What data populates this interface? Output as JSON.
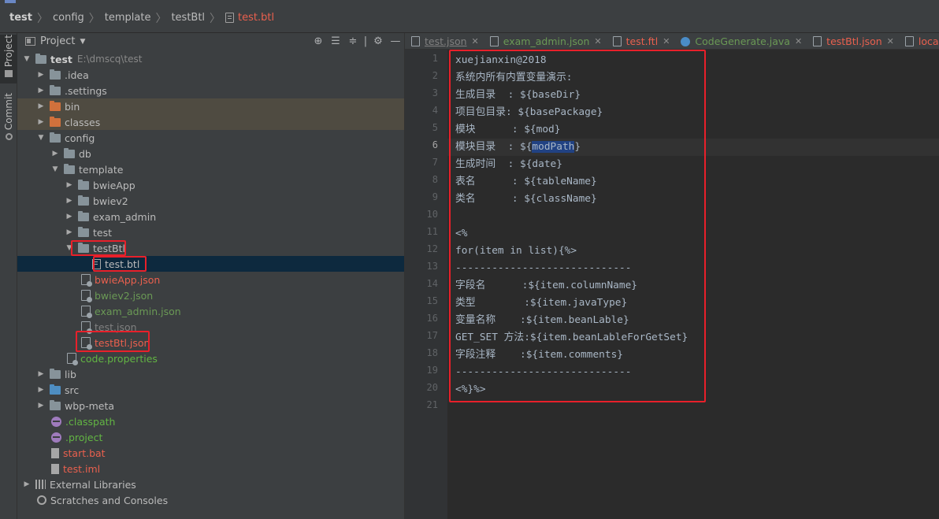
{
  "breadcrumb": {
    "items": [
      "test",
      "config",
      "template",
      "testBtl"
    ],
    "file": "test.btl"
  },
  "side": {
    "project_label": "Project",
    "commit_label": "Commit"
  },
  "project_panel": {
    "title": "Project",
    "tools": [
      "target-icon",
      "expand-all-icon",
      "collapse-all-icon",
      "gear-icon",
      "hide-icon"
    ]
  },
  "tree": {
    "root": {
      "label": "test",
      "path": "E:\\dmscq\\test"
    },
    "items": [
      {
        "label": ".idea"
      },
      {
        "label": ".settings"
      },
      {
        "label": "bin"
      },
      {
        "label": "classes"
      },
      {
        "label": "config"
      },
      {
        "label": "db"
      },
      {
        "label": "template"
      },
      {
        "label": "bwieApp"
      },
      {
        "label": "bwiev2"
      },
      {
        "label": "exam_admin"
      },
      {
        "label": "test"
      },
      {
        "label": "testBtl"
      },
      {
        "label": "test.btl"
      },
      {
        "label": "bwieApp.json"
      },
      {
        "label": "bwiev2.json"
      },
      {
        "label": "exam_admin.json"
      },
      {
        "label": "test.json"
      },
      {
        "label": "testBtl.json"
      },
      {
        "label": "code.properties"
      },
      {
        "label": "lib"
      },
      {
        "label": "src"
      },
      {
        "label": "wbp-meta"
      },
      {
        "label": ".classpath"
      },
      {
        "label": ".project"
      },
      {
        "label": "start.bat"
      },
      {
        "label": "test.iml"
      },
      {
        "label": "External Libraries"
      },
      {
        "label": "Scratches and Consoles"
      }
    ]
  },
  "tabs": [
    {
      "label": "test.json"
    },
    {
      "label": "exam_admin.json"
    },
    {
      "label": "test.ftl"
    },
    {
      "label": "CodeGenerate.java"
    },
    {
      "label": "testBtl.json"
    },
    {
      "label": "local_my"
    }
  ],
  "editor": {
    "line_numbers": [
      "1",
      "2",
      "3",
      "4",
      "5",
      "6",
      "7",
      "8",
      "9",
      "10",
      "11",
      "12",
      "13",
      "14",
      "15",
      "16",
      "17",
      "18",
      "19",
      "20",
      "21"
    ],
    "current_line": 6,
    "lines": [
      "xuejianxin@2018",
      "系统内所有内置变量演示:",
      "生成目录  : ${baseDir}",
      "项目包目录: ${basePackage}",
      "模块      : ${mod}",
      "模块目录  : ${",
      "生成时间  : ${date}",
      "表名      : ${tableName}",
      "类名      : ${className}",
      "",
      "<%",
      "for(item in list){%>",
      "-----------------------------",
      "字段名      :${item.columnName}",
      "类型        :${item.javaType}",
      "变量名称    :${item.beanLable}",
      "GET_SET 方法:${item.beanLableForGetSet}",
      "字段注释    :${item.comments}",
      "-----------------------------",
      "<%}%>",
      ""
    ],
    "line6_highlight": "modPath",
    "line6_tail": "}"
  }
}
